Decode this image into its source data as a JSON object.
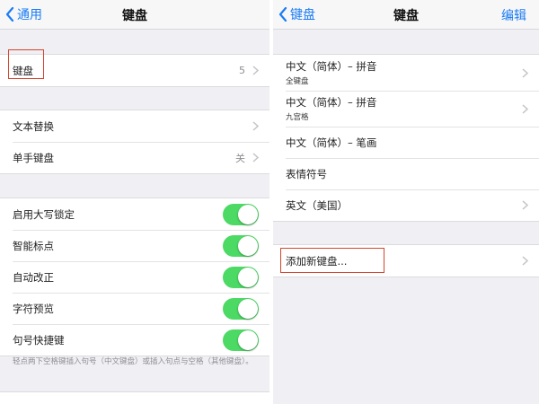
{
  "left": {
    "nav": {
      "back_label": "通用",
      "title": "键盘"
    },
    "keyboard_row": {
      "label": "键盘",
      "count": "5"
    },
    "text_group": [
      {
        "label": "文本替换",
        "detail": ""
      },
      {
        "label": "单手键盘",
        "detail": "关"
      }
    ],
    "toggles": [
      {
        "label": "启用大写锁定",
        "on": true
      },
      {
        "label": "智能标点",
        "on": true
      },
      {
        "label": "自动改正",
        "on": true
      },
      {
        "label": "字符预览",
        "on": true
      },
      {
        "label": "句号快捷键",
        "on": true
      }
    ],
    "footer_note": "轻点两下空格键插入句号（中文键盘）或插入句点与空格（其他键盘）。"
  },
  "right": {
    "nav": {
      "back_label": "键盘",
      "title": "键盘",
      "edit_label": "编辑"
    },
    "keyboards": [
      {
        "label": "中文（简体）– 拼音",
        "sub": "全键盘"
      },
      {
        "label": "中文（简体）– 拼音",
        "sub": "九宫格"
      },
      {
        "label": "中文（简体）– 笔画",
        "sub": ""
      },
      {
        "label": "表情符号",
        "sub": ""
      },
      {
        "label": "英文（美国）",
        "sub": ""
      }
    ],
    "add_keyboard_label": "添加新键盘..."
  },
  "colors": {
    "accent": "#1a7cf5",
    "toggle_on": "#4cd964",
    "highlight": "#d2452c"
  }
}
